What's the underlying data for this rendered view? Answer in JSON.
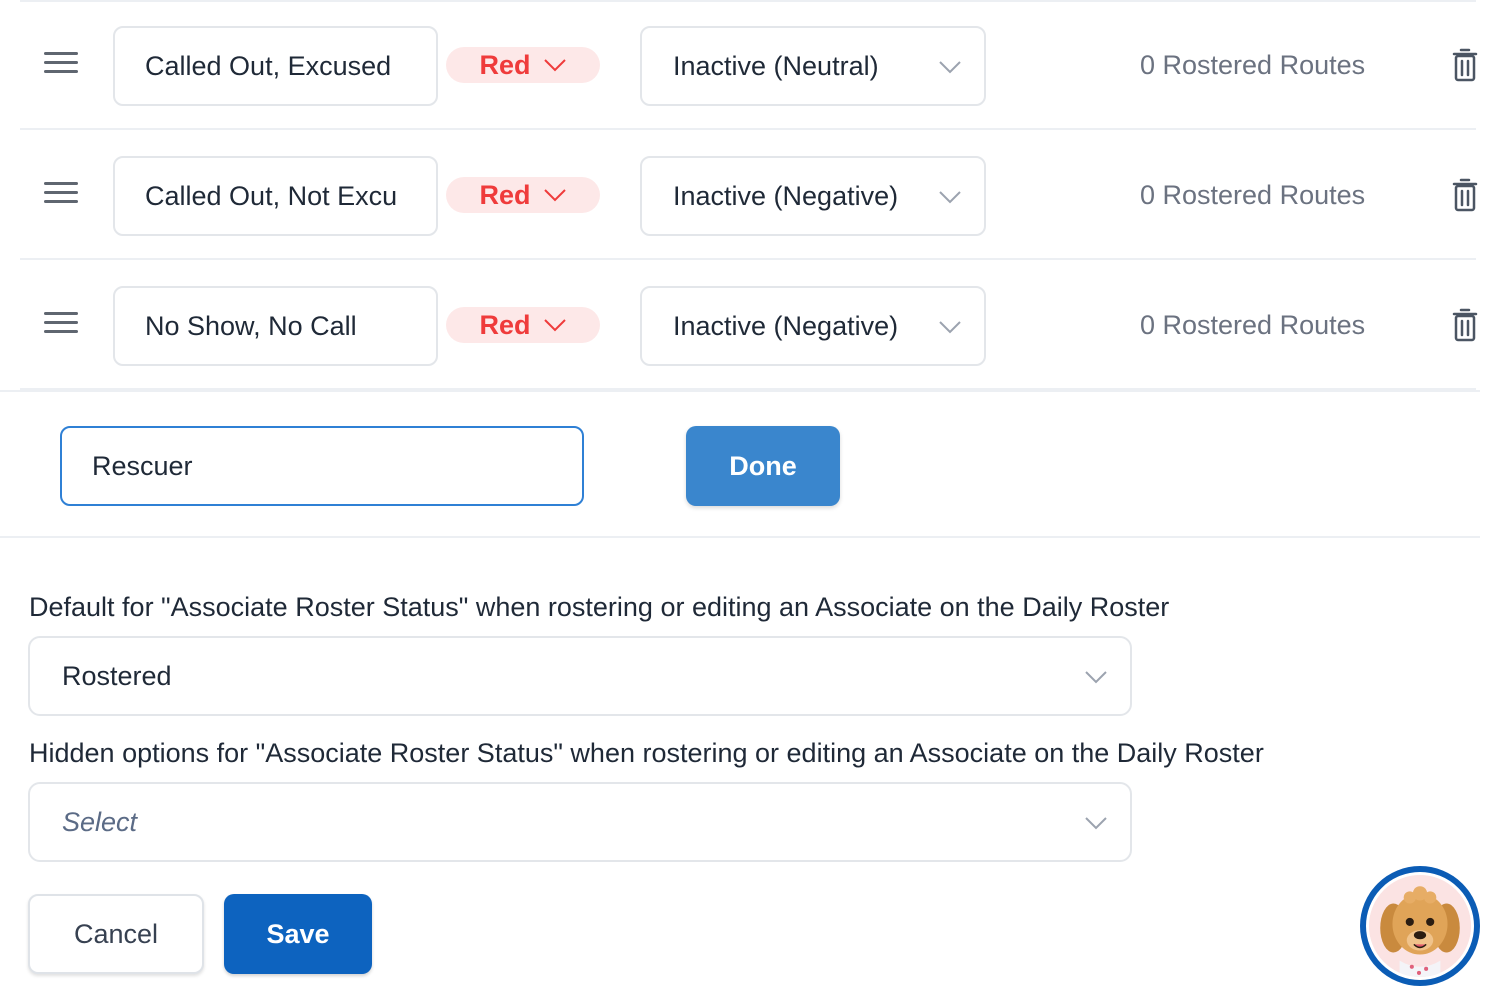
{
  "status_rows": [
    {
      "name": "Called Out, Excused",
      "color": "Red",
      "state": "Inactive (Neutral)",
      "routes": "0 Rostered Routes"
    },
    {
      "name": "Called Out, Not Excu",
      "color": "Red",
      "state": "Inactive (Negative)",
      "routes": "0 Rostered Routes"
    },
    {
      "name": "No Show, No Call",
      "color": "Red",
      "state": "Inactive (Negative)",
      "routes": "0 Rostered Routes"
    }
  ],
  "new_status": {
    "value": "Rescuer",
    "done_label": "Done"
  },
  "default_setting": {
    "label": "Default for \"Associate Roster Status\" when rostering or editing an Associate on the Daily Roster",
    "value": "Rostered"
  },
  "hidden_setting": {
    "label": "Hidden options for \"Associate Roster Status\" when rostering or editing an Associate on the Daily Roster",
    "placeholder": "Select"
  },
  "actions": {
    "cancel_label": "Cancel",
    "save_label": "Save"
  },
  "icons": {
    "drag": "drag-handle-icon",
    "chevron": "chevron-down-icon",
    "trash": "trash-icon",
    "avatar": "dog-avatar-icon"
  },
  "colors": {
    "red_text": "#ef3b3b",
    "red_pill_bg": "#fde8e8",
    "primary": "#0d63bf",
    "done_button": "#3a86cd",
    "focus_border": "#2f80d5"
  }
}
